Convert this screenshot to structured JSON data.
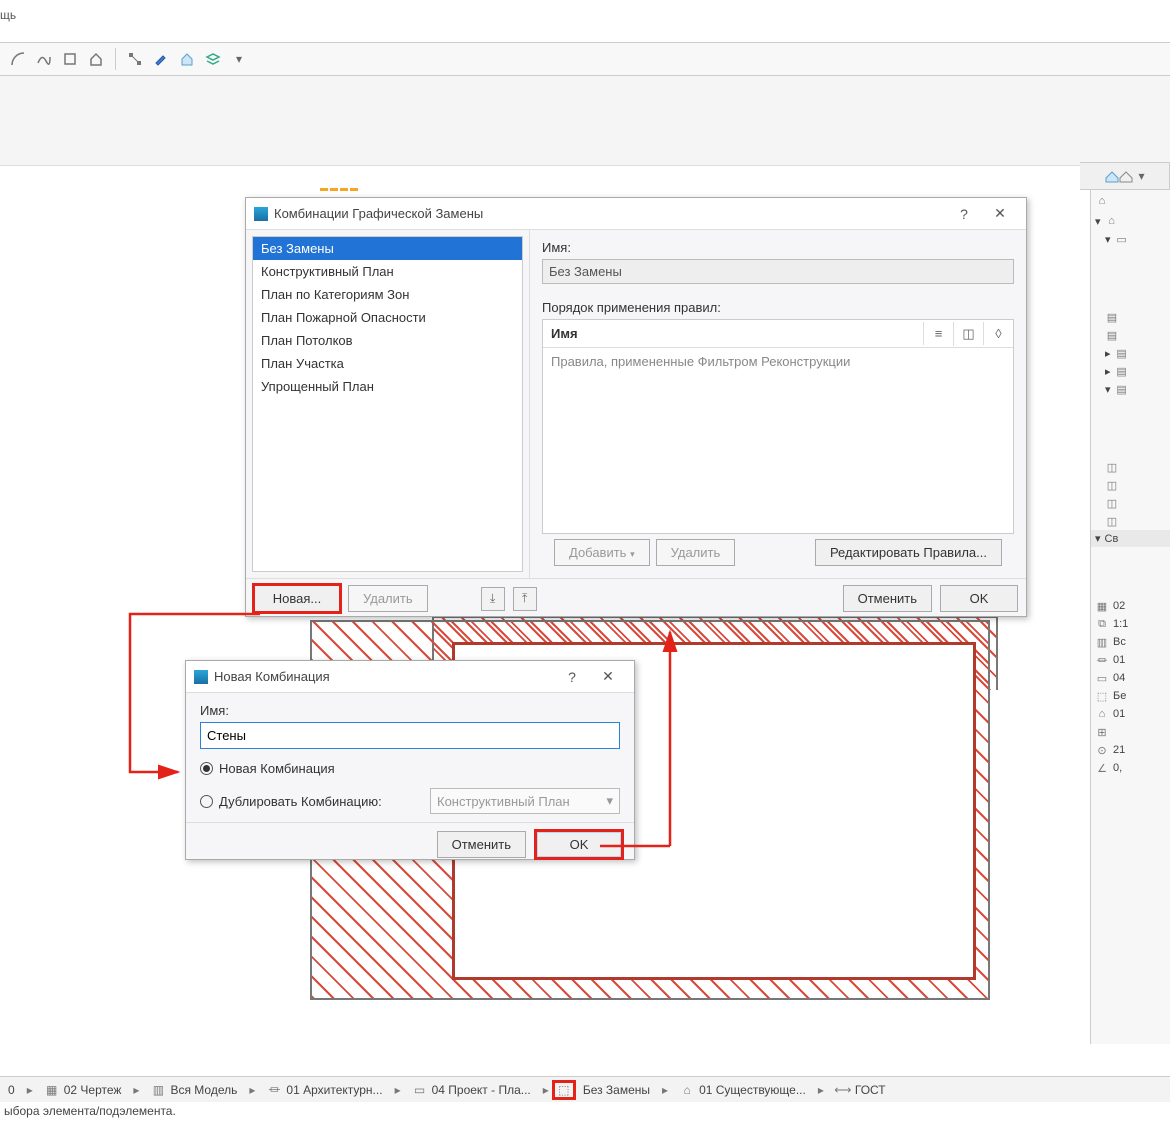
{
  "menu_fragment": "щь",
  "dlg1": {
    "title": "Комбинации Графической Замены",
    "help": "?",
    "list": [
      "Без Замены",
      "Конструктивный План",
      "План по Категориям Зон",
      "План Пожарной Опасности",
      "План Потолков",
      "План Участка",
      "Упрощенный План"
    ],
    "selected_index": 0,
    "name_label": "Имя:",
    "name_value": "Без Замены",
    "rules_label": "Порядок применения правил:",
    "rules_col_name": "Имя",
    "rules_placeholder": "Правила, примененные Фильтром Реконструкции",
    "btn_add": "Добавить",
    "btn_del_rule": "Удалить",
    "btn_edit_rules": "Редактировать Правила...",
    "btn_cancel": "Отменить",
    "btn_ok": "OK",
    "btn_new": "Новая...",
    "btn_delete": "Удалить"
  },
  "dlg2": {
    "title": "Новая Комбинация",
    "help": "?",
    "name_label": "Имя:",
    "name_value": "Стены",
    "radio_new": "Новая Комбинация",
    "radio_dup": "Дублировать Комбинацию:",
    "combo_value": "Конструктивный План",
    "btn_cancel": "Отменить",
    "btn_ok": "OK"
  },
  "statusbar": {
    "s0": "0",
    "s1": "02 Чертеж",
    "s2": "Вся Модель",
    "s3": "01 Архитектурн...",
    "s4": "04 Проект - Пла...",
    "s5": "Без Замены",
    "s6": "01 Существующе...",
    "s7": "ГОСТ"
  },
  "hint": "ыбора элемента/подэлемента.",
  "right": {
    "header": "Св",
    "r1": "02",
    "r2": "1:1",
    "r3": "Вс",
    "r4": "01",
    "r5": "04",
    "r6": "Бе",
    "r7": "01",
    "r8": "21",
    "r9": "0,"
  }
}
